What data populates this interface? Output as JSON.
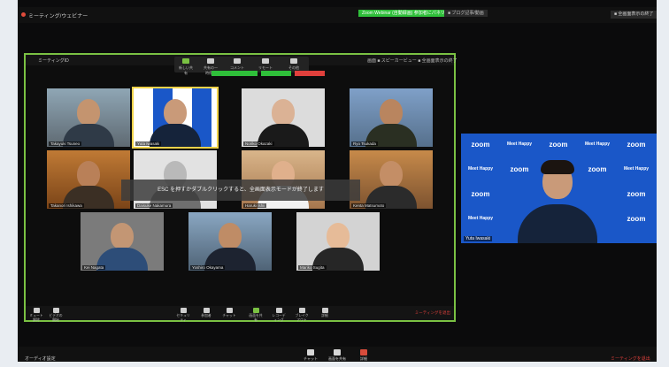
{
  "window": {
    "title": "ミーティング/ウェビナー",
    "recording_badge": "Zoom Webinar (自動録画) 参加者にパネリスト",
    "rec_status": "■ ブログ記事/動画",
    "view_button": "■ 全画面表示の終了"
  },
  "share": {
    "title": "ミーティングID",
    "right_label": "画面  ■ スピーカービュー  ■ 全画面表示の終了",
    "toolbar": [
      "新しい共有",
      "共有の一時停止",
      "コメントを付ける",
      "リモート制御",
      "その他"
    ],
    "overlay_message": "ESC を押すかダブルクリックすると、全画面表示モードが終了します",
    "bottom_items": [
      "ミュート解除",
      "ビデオの開始",
      "セキュリティ",
      "参加者",
      "チャット",
      "画面を共有",
      "レコーディング",
      "ブレイクアウト",
      "詳細"
    ],
    "end_label": "ミーティングを退出"
  },
  "participants": [
    {
      "name": "Takayuki Tsuneo"
    },
    {
      "name": "Yuta Iwasaki"
    },
    {
      "name": "Noriko Okazaki"
    },
    {
      "name": "Ryo Tsukada"
    },
    {
      "name": "Takanori Ishikawa"
    },
    {
      "name": "Daisuke Nakamura"
    },
    {
      "name": "Haruki Ishii"
    },
    {
      "name": "Kenta Matsumoto"
    },
    {
      "name": "Kei Nagata"
    },
    {
      "name": "Yoshiro Okayama"
    },
    {
      "name": "Mariko Sugita"
    }
  ],
  "speaker": {
    "name": "Yuta Iwasaki",
    "wall_text": [
      "zoom",
      "Meet Happy"
    ]
  },
  "main_toolbar": {
    "audio_label": "オーディオ設定",
    "items": [
      "チャット",
      "画面を共有",
      "詳細"
    ],
    "end_label": "ミーティングを退出"
  },
  "colors": {
    "share_border": "#7ac143",
    "wall_blue": "#1a57c8",
    "end_red": "#e0403c",
    "recording_green": "#2fbf3a"
  }
}
